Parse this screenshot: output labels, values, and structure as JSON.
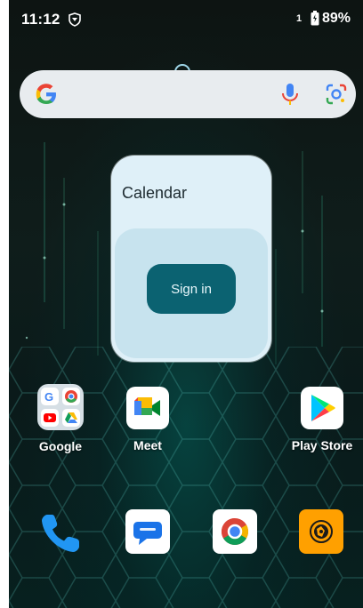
{
  "status_bar": {
    "time": "11:12",
    "sim_indicator": "1",
    "battery": "89%"
  },
  "search_bar": {
    "icons": [
      "google-g-icon",
      "microphone-icon",
      "google-lens-icon"
    ]
  },
  "calendar_widget": {
    "title": "Calendar",
    "button_label": "Sign in"
  },
  "home_apps": [
    {
      "label": "Google",
      "icon": "google-folder-icon"
    },
    {
      "label": "Meet",
      "icon": "meet-icon"
    },
    {
      "label": "Play Store",
      "icon": "play-store-icon"
    }
  ],
  "dock": [
    {
      "icon": "phone-icon"
    },
    {
      "icon": "messages-icon"
    },
    {
      "icon": "chrome-icon"
    },
    {
      "icon": "camera-icon"
    }
  ],
  "colors": {
    "widget_bg": "#dff0f8",
    "signin_button": "#0b6271",
    "search_bg": "#e8ecef"
  }
}
